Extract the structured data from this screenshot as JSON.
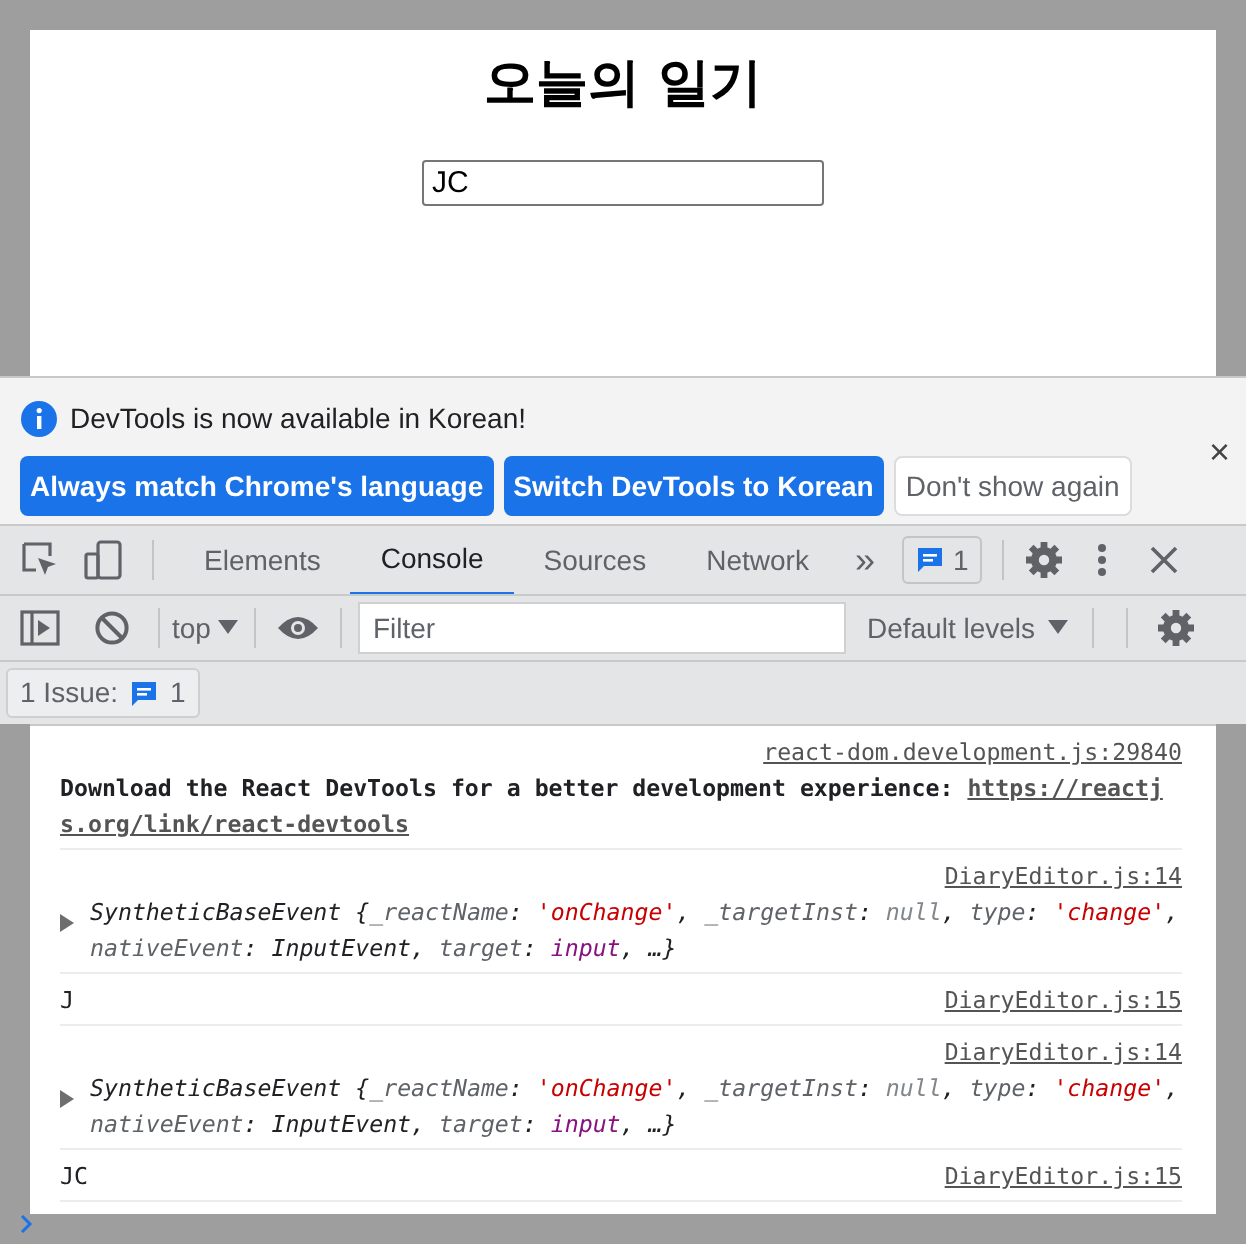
{
  "page": {
    "title": "오늘의 일기",
    "input_value": "JC"
  },
  "infobar": {
    "message": "DevTools is now available in Korean!",
    "buttons": [
      {
        "label": "Always match Chrome's language",
        "kind": "primary"
      },
      {
        "label": "Switch DevTools to Korean",
        "kind": "primary"
      },
      {
        "label": "Don't show again",
        "kind": "secondary"
      }
    ],
    "close": "×"
  },
  "tabs": [
    {
      "label": "Elements",
      "selected": false
    },
    {
      "label": "Console",
      "selected": true
    },
    {
      "label": "Sources",
      "selected": false
    },
    {
      "label": "Network",
      "selected": false
    }
  ],
  "more_tabs": "»",
  "issues_badge": "1",
  "console_toolbar": {
    "context": "top",
    "filter_placeholder": "Filter",
    "levels": "Default levels"
  },
  "issues_bar": {
    "label": "1 Issue:",
    "count": "1"
  },
  "messages": [
    {
      "kind": "text",
      "source": "react-dom.development.js:29840",
      "text": "Download the React DevTools for a better development experience: ",
      "link": "https://reactjs.org/link/react-devtools"
    },
    {
      "kind": "object",
      "source": "DiaryEditor.js:14",
      "tokens": [
        {
          "text": "SyntheticBaseEvent {",
          "kind": "plain"
        },
        {
          "text": "_reactName",
          "kind": "key"
        },
        {
          "text": ": ",
          "kind": "plain"
        },
        {
          "text": "'onChange'",
          "kind": "string"
        },
        {
          "text": ", ",
          "kind": "plain"
        },
        {
          "text": "_targetInst",
          "kind": "key"
        },
        {
          "text": ": ",
          "kind": "plain"
        },
        {
          "text": "null",
          "kind": "null"
        },
        {
          "text": ", ",
          "kind": "plain"
        },
        {
          "text": "type",
          "kind": "key"
        },
        {
          "text": ": ",
          "kind": "plain"
        },
        {
          "text": "'change'",
          "kind": "string"
        },
        {
          "text": ", ",
          "kind": "plain"
        },
        {
          "text": "nativeEvent",
          "kind": "key"
        },
        {
          "text": ": InputEvent, ",
          "kind": "plain"
        },
        {
          "text": "target",
          "kind": "key"
        },
        {
          "text": ": ",
          "kind": "plain"
        },
        {
          "text": "input",
          "kind": "element"
        },
        {
          "text": ", …}",
          "kind": "plain"
        }
      ]
    },
    {
      "kind": "plain",
      "source": "DiaryEditor.js:15",
      "text": "J"
    },
    {
      "kind": "object",
      "source": "DiaryEditor.js:14",
      "tokens": [
        {
          "text": "SyntheticBaseEvent {",
          "kind": "plain"
        },
        {
          "text": "_reactName",
          "kind": "key"
        },
        {
          "text": ": ",
          "kind": "plain"
        },
        {
          "text": "'onChange'",
          "kind": "string"
        },
        {
          "text": ", ",
          "kind": "plain"
        },
        {
          "text": "_targetInst",
          "kind": "key"
        },
        {
          "text": ": ",
          "kind": "plain"
        },
        {
          "text": "null",
          "kind": "null"
        },
        {
          "text": ", ",
          "kind": "plain"
        },
        {
          "text": "type",
          "kind": "key"
        },
        {
          "text": ": ",
          "kind": "plain"
        },
        {
          "text": "'change'",
          "kind": "string"
        },
        {
          "text": ", ",
          "kind": "plain"
        },
        {
          "text": "nativeEvent",
          "kind": "key"
        },
        {
          "text": ": InputEvent, ",
          "kind": "plain"
        },
        {
          "text": "target",
          "kind": "key"
        },
        {
          "text": ": ",
          "kind": "plain"
        },
        {
          "text": "input",
          "kind": "element"
        },
        {
          "text": ", …}",
          "kind": "plain"
        }
      ]
    },
    {
      "kind": "plain",
      "source": "DiaryEditor.js:15",
      "text": "JC"
    }
  ]
}
